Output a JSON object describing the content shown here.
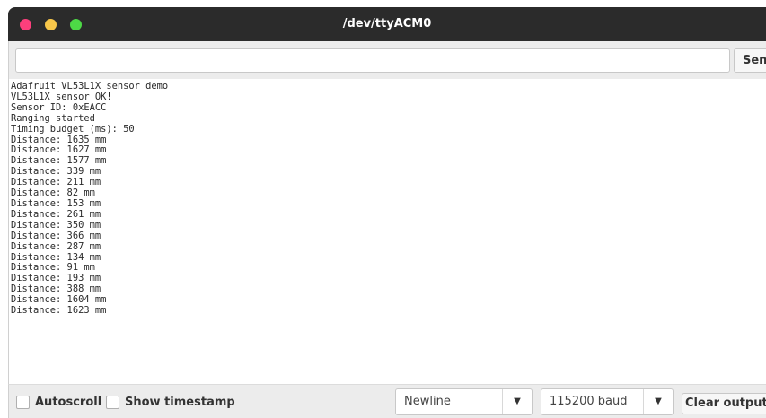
{
  "window": {
    "title": "/dev/ttyACM0",
    "controls": [
      "close-icon",
      "minimize-icon",
      "maximize-icon"
    ]
  },
  "send": {
    "input_value": "",
    "button_label": "Send"
  },
  "output": {
    "lines": [
      "Adafruit VL53L1X sensor demo",
      "VL53L1X sensor OK!",
      "Sensor ID: 0xEACC",
      "Ranging started",
      "Timing budget (ms): 50",
      "Distance: 1635 mm",
      "Distance: 1627 mm",
      "Distance: 1577 mm",
      "Distance: 339 mm",
      "Distance: 211 mm",
      "Distance: 82 mm",
      "Distance: 153 mm",
      "Distance: 261 mm",
      "Distance: 350 mm",
      "Distance: 366 mm",
      "Distance: 287 mm",
      "Distance: 134 mm",
      "Distance: 91 mm",
      "Distance: 193 mm",
      "Distance: 388 mm",
      "Distance: 1604 mm",
      "Distance: 1623 mm"
    ]
  },
  "footer": {
    "autoscroll_label": "Autoscroll",
    "autoscroll_checked": false,
    "timestamp_label": "Show timestamp",
    "timestamp_checked": false,
    "line_ending": "Newline",
    "baud_rate": "115200 baud",
    "clear_label": "Clear output"
  },
  "colors": {
    "titlebar": "#2b2b2b",
    "close": "#fd3f7c",
    "minimize": "#f8c74a",
    "maximize": "#4dd946"
  }
}
